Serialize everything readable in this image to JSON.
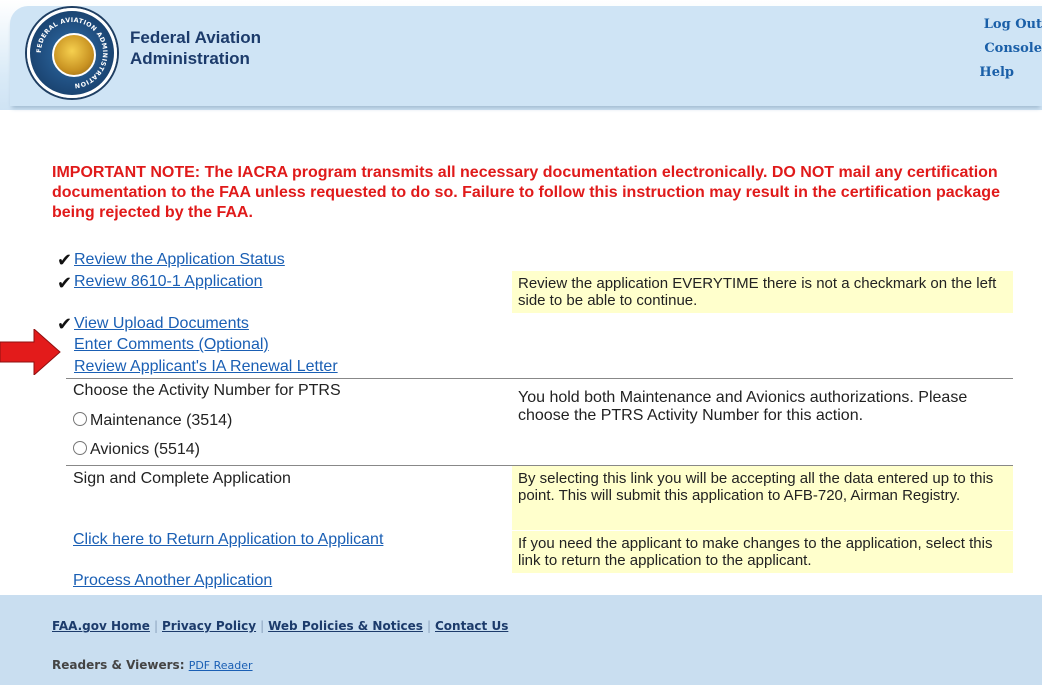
{
  "header": {
    "agency_line1": "Federal Aviation",
    "agency_line2": "Administration",
    "seal_text": "FEDERAL AVIATION ADMINISTRATION",
    "links": {
      "logout": "Log Out",
      "console": "Console",
      "help": "Help"
    }
  },
  "note": "IMPORTANT NOTE: The IACRA program transmits all necessary documentation electronically. DO NOT mail any certification documentation to the FAA unless requested to do so. Failure to follow this instruction may result in the certification package being rejected by the FAA.",
  "links": {
    "review_status": "Review the Application Status",
    "review_8610": "Review 8610-1 Application",
    "view_uploads": "View Upload Documents",
    "enter_comments": "Enter Comments (Optional)",
    "review_ia_letter": "Review Applicant's IA Renewal Letter",
    "return_application": "Click here to Return Application to Applicant",
    "process_another": "Process Another Application"
  },
  "check_glyph": "✔",
  "info": {
    "review_everytime": "Review the application EVERYTIME there is not a checkmark on the left side to be able to continue.",
    "ptrs_both": "You hold both Maintenance and Avionics authorizations. Please choose the PTRS Activity Number for this action.",
    "sign_accept": "By selecting this link you will be accepting all the data entered up to this point. This will submit this application to AFB-720, Airman Registry.",
    "return_help": "If you need the applicant to make changes to the application, select this link to return the application to the applicant."
  },
  "ptrs": {
    "label": "Choose the Activity Number for PTRS",
    "options": [
      "Maintenance (3514)",
      "Avionics (5514)"
    ]
  },
  "sign": {
    "label": "Sign and Complete Application"
  },
  "footer": {
    "links": [
      "FAA.gov Home",
      "Privacy Policy",
      "Web Policies & Notices",
      "Contact Us"
    ],
    "separator": "|",
    "readers_label": "Readers & Viewers:",
    "pdf_reader": "PDF Reader"
  },
  "colors": {
    "note_red": "#e01a1a",
    "link_blue": "#1a5fb4",
    "info_yellow": "#ffffcc",
    "header_blue": "#cfe4f5",
    "arrow_red": "#e31b1b"
  },
  "icons": {
    "seal": "faa-seal-icon",
    "check": "checkmark-icon",
    "arrow": "red-arrow-icon",
    "radio": "radio-button-icon"
  }
}
